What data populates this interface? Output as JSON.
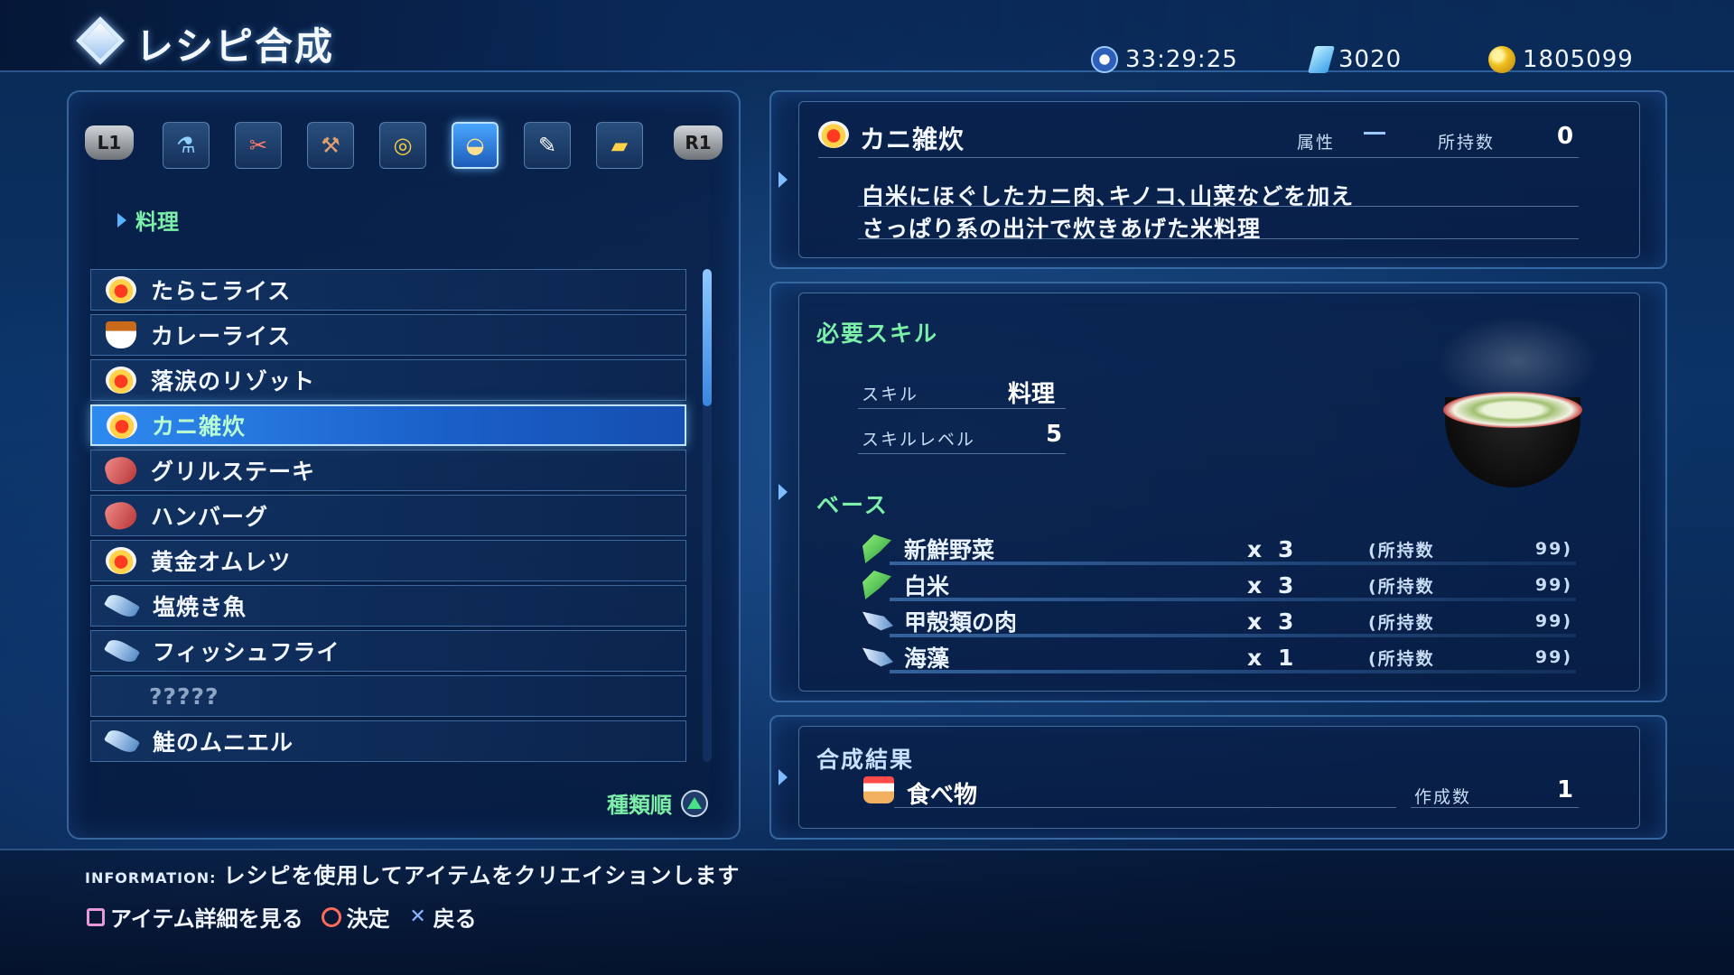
{
  "header": {
    "title": "レシピ合成",
    "play_time": "33:29:25",
    "crystals": "3020",
    "money": "1805099"
  },
  "tabs": {
    "left_shoulder": "L1",
    "right_shoulder": "R1",
    "items": [
      {
        "icon": "potion-icon"
      },
      {
        "icon": "tools-icon"
      },
      {
        "icon": "hammer-icon"
      },
      {
        "icon": "accessory-icon"
      },
      {
        "icon": "cooking-icon",
        "active": true
      },
      {
        "icon": "writing-icon"
      },
      {
        "icon": "ingot-icon"
      }
    ]
  },
  "category": "料理",
  "recipes": [
    {
      "name": "たらこライス",
      "icon": "rice"
    },
    {
      "name": "カレーライス",
      "icon": "curry"
    },
    {
      "name": "落涙のリゾット",
      "icon": "rice"
    },
    {
      "name": "カニ雑炊",
      "icon": "rice",
      "selected": true
    },
    {
      "name": "グリルステーキ",
      "icon": "meat"
    },
    {
      "name": "ハンバーグ",
      "icon": "meat"
    },
    {
      "name": "黄金オムレツ",
      "icon": "rice"
    },
    {
      "name": "塩焼き魚",
      "icon": "fish"
    },
    {
      "name": "フィッシュフライ",
      "icon": "fish"
    },
    {
      "name": "?????",
      "icon": ""
    },
    {
      "name": "鮭のムニエル",
      "icon": "fish"
    }
  ],
  "sort_label": "種類順",
  "detail": {
    "name": "カニ雑炊",
    "attribute_label": "属性",
    "owned_label": "所持数",
    "owned_value": "0",
    "description": [
      "白米にほぐしたカニ肉､キノコ､山菜などを加え",
      "さっぱり系の出汁で炊きあげた米料理"
    ]
  },
  "requirements": {
    "skill_header": "必要スキル",
    "skill_label": "スキル",
    "skill_value": "料理",
    "level_label": "スキルレベル",
    "level_value": "5",
    "base_header": "ベース",
    "materials": [
      {
        "name": "新鮮野菜",
        "icon": "leaf",
        "times": "x",
        "qty": "3",
        "owned_label": "(所持数",
        "owned": "99)"
      },
      {
        "name": "白米",
        "icon": "leaf",
        "times": "x",
        "qty": "3",
        "owned_label": "(所持数",
        "owned": "99)"
      },
      {
        "name": "甲殻類の肉",
        "icon": "fish",
        "times": "x",
        "qty": "3",
        "owned_label": "(所持数",
        "owned": "99)"
      },
      {
        "name": "海藻",
        "icon": "fish",
        "times": "x",
        "qty": "1",
        "owned_label": "(所持数",
        "owned": "99)"
      }
    ]
  },
  "result": {
    "header": "合成結果",
    "item": "食べ物",
    "count_label": "作成数",
    "count": "1"
  },
  "info": {
    "label": "INFORMATION:",
    "text": "レシピを使用してアイテムをクリエイションします"
  },
  "controls": {
    "detail": "アイテム詳細を見る",
    "confirm": "決定",
    "back": "戻る"
  }
}
